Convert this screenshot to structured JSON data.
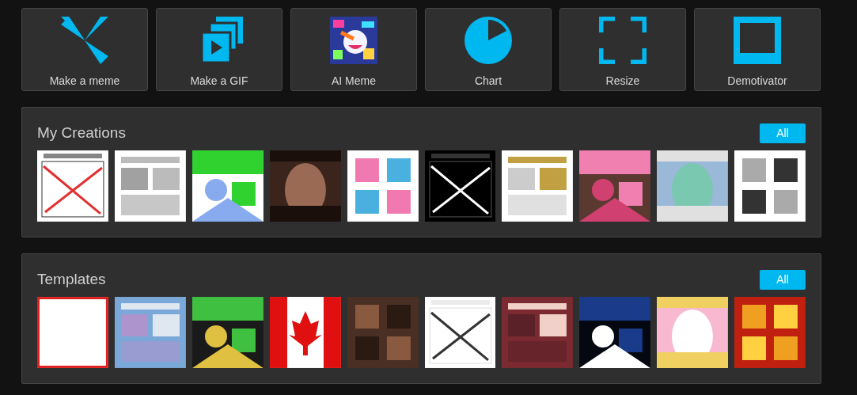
{
  "tools": [
    {
      "label": "Make a meme",
      "kind": "pinwheel"
    },
    {
      "label": "Make a GIF",
      "kind": "gif"
    },
    {
      "label": "AI Meme",
      "kind": "ai"
    },
    {
      "label": "Chart",
      "kind": "chart"
    },
    {
      "label": "Resize",
      "kind": "resize"
    },
    {
      "label": "Demotivator",
      "kind": "demotivator"
    }
  ],
  "sections": [
    {
      "title": "My Creations",
      "button": "All"
    },
    {
      "title": "Templates",
      "button": "All"
    }
  ]
}
